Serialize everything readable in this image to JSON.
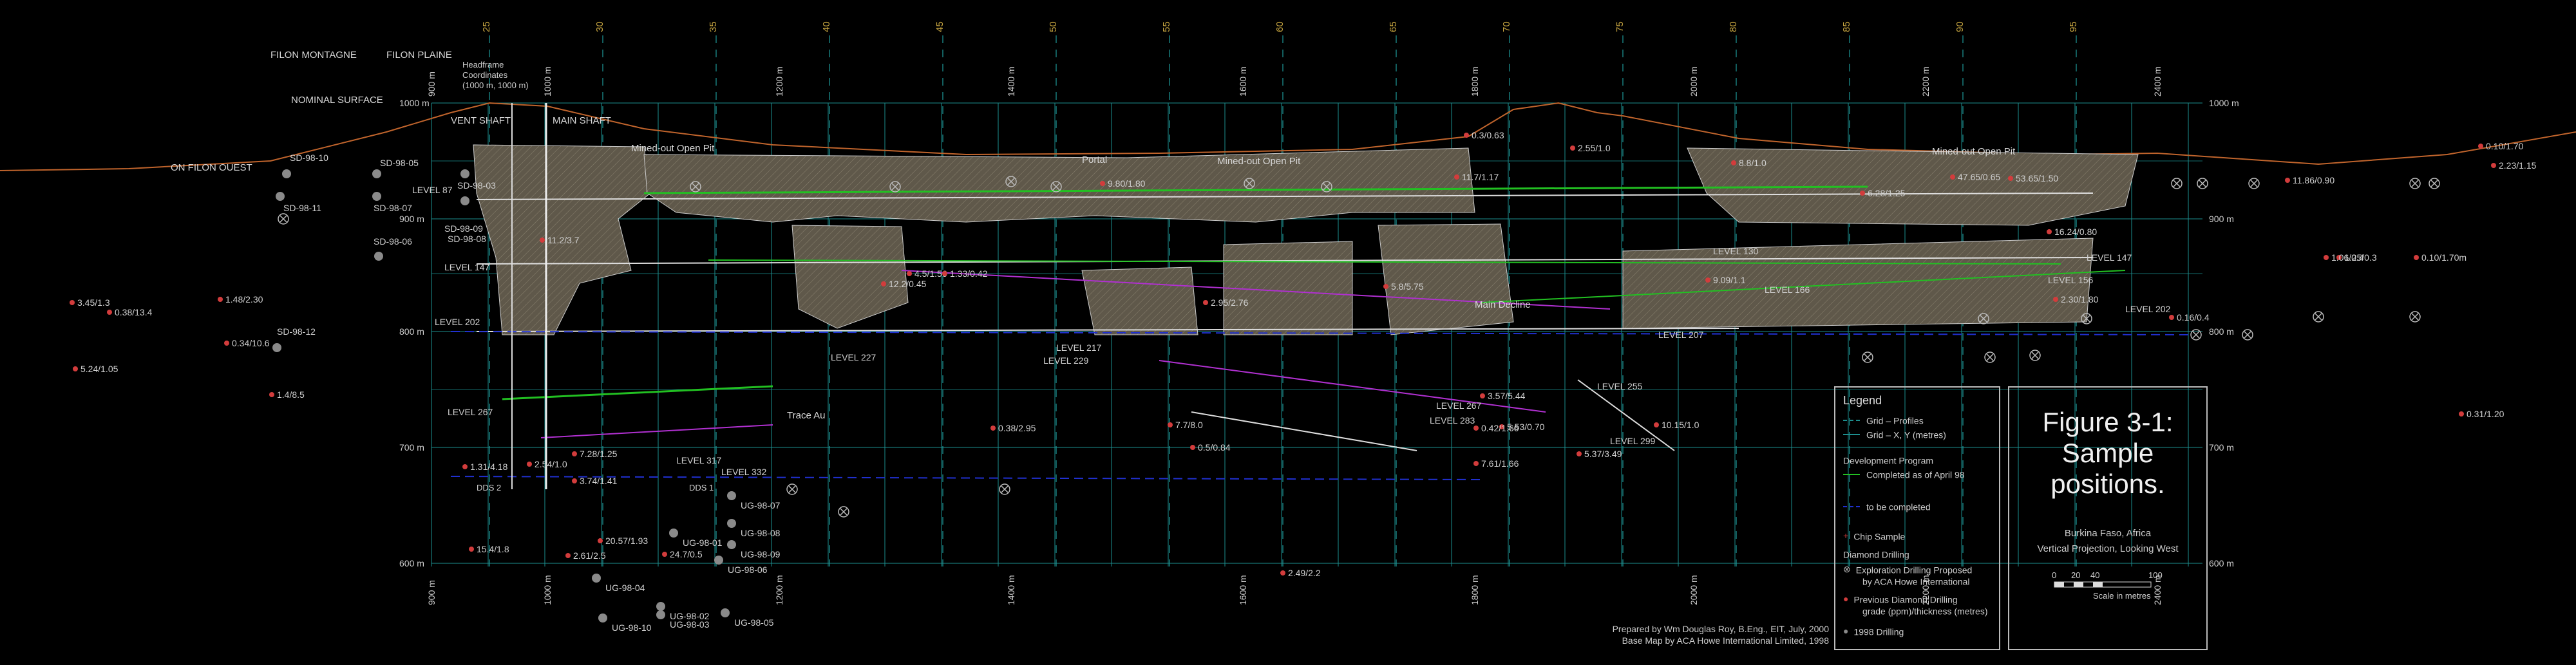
{
  "x_axis_top": [
    "25",
    "30",
    "35",
    "40",
    "45",
    "50",
    "55",
    "60",
    "65",
    "70",
    "75",
    "80",
    "85",
    "90",
    "95"
  ],
  "x_axis_metres": [
    "900 m",
    "1000 m",
    "1200 m",
    "1400 m",
    "1600 m",
    "1800 m",
    "2000 m",
    "2200 m",
    "2400 m"
  ],
  "y_axis_levels": [
    "1000 m",
    "900 m",
    "800 m",
    "700 m",
    "600 m"
  ],
  "filon": {
    "montagne": "FILON MONTAGNE",
    "plaine": "FILON PLAINE"
  },
  "headframe": "Headframe\nCoordinates\n(1000 m, 1000 m)",
  "shafts": {
    "vent": "VENT SHAFT",
    "main": "MAIN SHAFT"
  },
  "nominal_surface": "NOMINAL SURFACE",
  "on_filon_ouest": "ON FILON OUEST",
  "mined_out": [
    "Mined-out Open Pit",
    "Mined-out Open Pit",
    "Mined-out Open Pit"
  ],
  "portal": "Portal",
  "main_decline": "Main Decline",
  "levels": [
    "LEVEL 87",
    "LEVEL 147",
    "LEVEL 202",
    "LEVEL 267",
    "LEVEL 317",
    "LEVEL 332",
    "LEVEL 227",
    "LEVEL 217",
    "LEVEL 229",
    "LEVEL 283",
    "LEVEL 267",
    "LEVEL 255",
    "LEVEL 299",
    "LEVEL 207",
    "LEVEL 166",
    "LEVEL 130",
    "LEVEL 156",
    "LEVEL 147",
    "LEVEL 202"
  ],
  "trace_au": "Trace Au",
  "dds": [
    "DDS 2",
    "DDS 1"
  ],
  "drill_labels_sd": [
    "SD-98-10",
    "SD-98-05",
    "SD-98-11",
    "SD-98-07",
    "SD-98-09",
    "SD-98-08",
    "SD-98-06",
    "SD-98-12",
    "SD-98-03"
  ],
  "drill_labels_ug": [
    "UG-98-07",
    "UG-98-01",
    "UG-98-08",
    "UG-98-06",
    "UG-98-09",
    "UG-98-04",
    "UG-98-02",
    "UG-98-10",
    "UG-98-03",
    "UG-98-05"
  ],
  "grades": [
    "3.45/1.3",
    "0.38/13.4",
    "1.48/2.30",
    "0.34/10.6",
    "5.24/1.05",
    "1.4/8.5",
    "1.31/4.18",
    "2.54/1.0",
    "3.74/1.41",
    "7.28/1.25",
    "15.4/1.8",
    "20.57/1.93",
    "24.7/0.5",
    "2.61/2.5",
    "0.38/2.95",
    "12.2/0.45",
    "4.5/1.56",
    "2.95/2.76",
    "11.2/3.7",
    "0.5/0.84",
    "2.49/2.2",
    "10.15/1.0",
    "5.53/0.70",
    "2.55/1.0",
    "0.3/0.63",
    "11.86/0.90",
    "0.10/1.70",
    "2.23/1.15",
    "1.25/0.3",
    "1.06/0.4",
    "0.10/1.70m",
    "0.31/1.20",
    "16.24/0.80",
    "2.30/1.80",
    "6.28/1.25",
    "47.65/0.65",
    "53.65/1.50",
    "9.80/1.80",
    "5.8/5.75",
    "8.8/1.0",
    "11.7/1.17",
    "9.09/1.1",
    "7.7/8.0",
    "3.57/5.44",
    "0.42/1.66",
    "5.37/3.49",
    "7.61/1.66",
    "0.16/0.4",
    "1.33/0.42"
  ],
  "legend": {
    "title": "Legend",
    "grid_profiles": "Grid – Profiles",
    "grid_xy": "Grid – X, Y (metres)",
    "dev_program": "Development Program",
    "completed": "Completed as of April 98",
    "to_complete": "to be completed",
    "chip_sample": "Chip Sample",
    "diamond_drilling": "Diamond Drilling",
    "exploration": "Exploration Drilling Proposed",
    "exploration2": "by ACA Howe International",
    "previous": "Previous Diamond Drilling",
    "previous2": "grade (ppm)/thickness (metres)",
    "drilling_1998": "1998 Drilling"
  },
  "figure": {
    "title_line1": "Figure 3-1:",
    "title_line2": "Sample",
    "title_line3": "positions.",
    "location": "Burkina Faso, Africa",
    "projection": "Vertical Projection, Looking West",
    "scale_ticks": [
      "0",
      "20",
      "40",
      "100"
    ],
    "scale_label": "Scale in metres"
  },
  "prepared": {
    "line1": "Prepared by Wm Douglas Roy, B.Eng., EIT, July, 2000",
    "line2": "Base Map by ACA Howe International Limited, 1998"
  },
  "colors": {
    "grid": "#1d8f8f",
    "profile": "#0fa0a0",
    "surface": "#c0642c",
    "stope_fill": "#6e6656",
    "dev_green": "#22c022",
    "dev_magenta": "#b030d0",
    "dev_blue": "#2030d0",
    "drill_red": "#d23c3c",
    "drill_grey": "#8a8a8a",
    "axis_label": "#c8a640"
  }
}
